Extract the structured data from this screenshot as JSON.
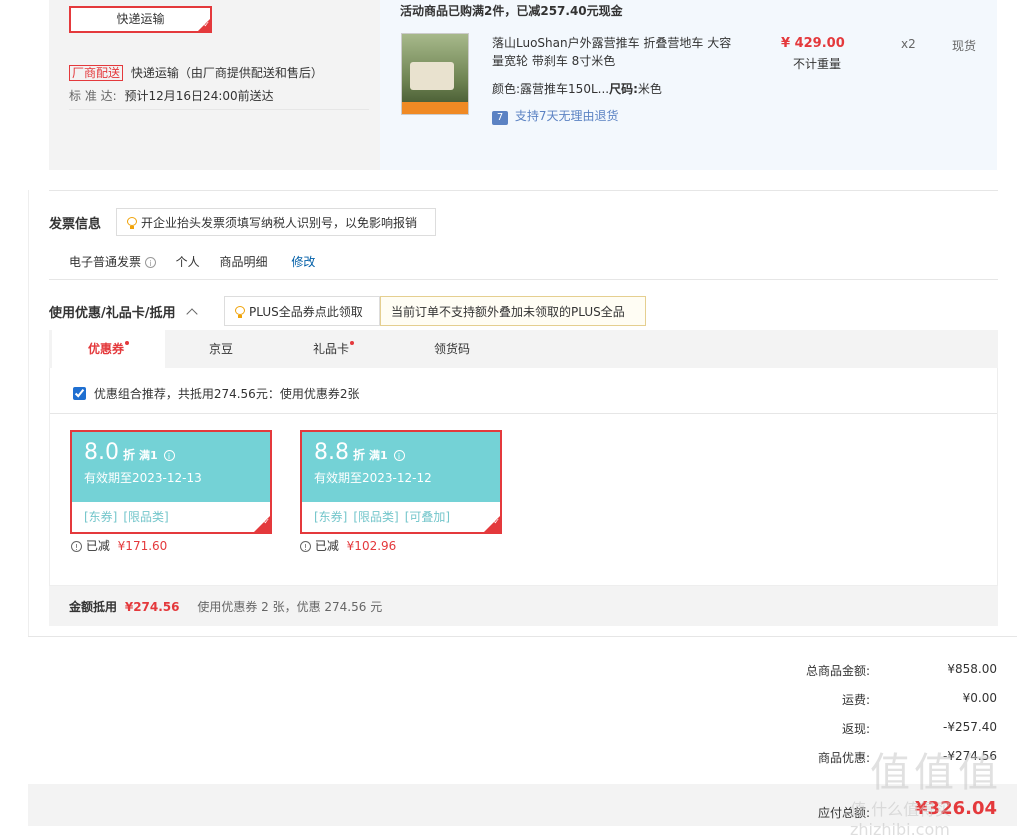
{
  "shipping": {
    "method_button": "快递运输",
    "vendor_tag": "厂商配送",
    "vendor_desc": "快递运输（由厂商提供配送和售后）",
    "standard_label": "标 准 达:",
    "standard_value": "预计12月16日24:00前送达"
  },
  "order": {
    "promo_text": "活动商品已购满2件，已减257.40元现金",
    "product_title": "落山LuoShan户外露营推车 折叠营地车 大容量宽轮 带刹车 8寸米色",
    "spec_color_label": "颜色:",
    "spec_color_value": "露营推车150L...",
    "spec_size_label": "尺码:",
    "spec_size_value": "米色",
    "return_badge": "7",
    "return_text": "支持7天无理由退货",
    "price": "¥ 429.00",
    "weight": "不计重量",
    "qty": "x2",
    "stock": "现货"
  },
  "invoice": {
    "title": "发票信息",
    "tip": "开企业抬头发票须填写纳税人识别号，以免影响报销",
    "type": "电子普通发票",
    "person": "个人",
    "content": "商品明细",
    "edit": "修改"
  },
  "discount": {
    "title": "使用优惠/礼品卡/抵用",
    "plus_tip": "PLUS全品券点此领取",
    "plus_notice": "当前订单不支持额外叠加未领取的PLUS全品券",
    "tabs": [
      "优惠券",
      "京豆",
      "礼品卡",
      "领货码"
    ],
    "combo_text": "优惠组合推荐，共抵用274.56元：使用优惠券2张",
    "coupons": [
      {
        "discount": "8.0",
        "unit": "折",
        "cond": "满1",
        "valid": "有效期至2023-12-13",
        "tags": [
          "[东券]",
          "[限品类]"
        ],
        "saved_label": "已减",
        "saved": "¥171.60"
      },
      {
        "discount": "8.8",
        "unit": "折",
        "cond": "满1",
        "valid": "有效期至2023-12-12",
        "tags": [
          "[东券]",
          "[限品类]",
          "[可叠加]"
        ],
        "saved_label": "已减",
        "saved": "¥102.96"
      }
    ],
    "footer_label": "金额抵用",
    "footer_amount": "¥274.56",
    "footer_desc": "使用优惠券 2 张，优惠 274.56 元"
  },
  "summary": {
    "total_label": "总商品金额:",
    "total_value": "¥858.00",
    "freight_label": "运费:",
    "freight_value": "¥0.00",
    "rebate_label": "返现:",
    "rebate_value": "-¥257.40",
    "coupon_label": "商品优惠:",
    "coupon_value": "-¥274.56",
    "pay_label": "应付总额:",
    "pay_value": "¥326.04"
  },
  "watermark": "值 什么值得买 zhizhibi.com"
}
